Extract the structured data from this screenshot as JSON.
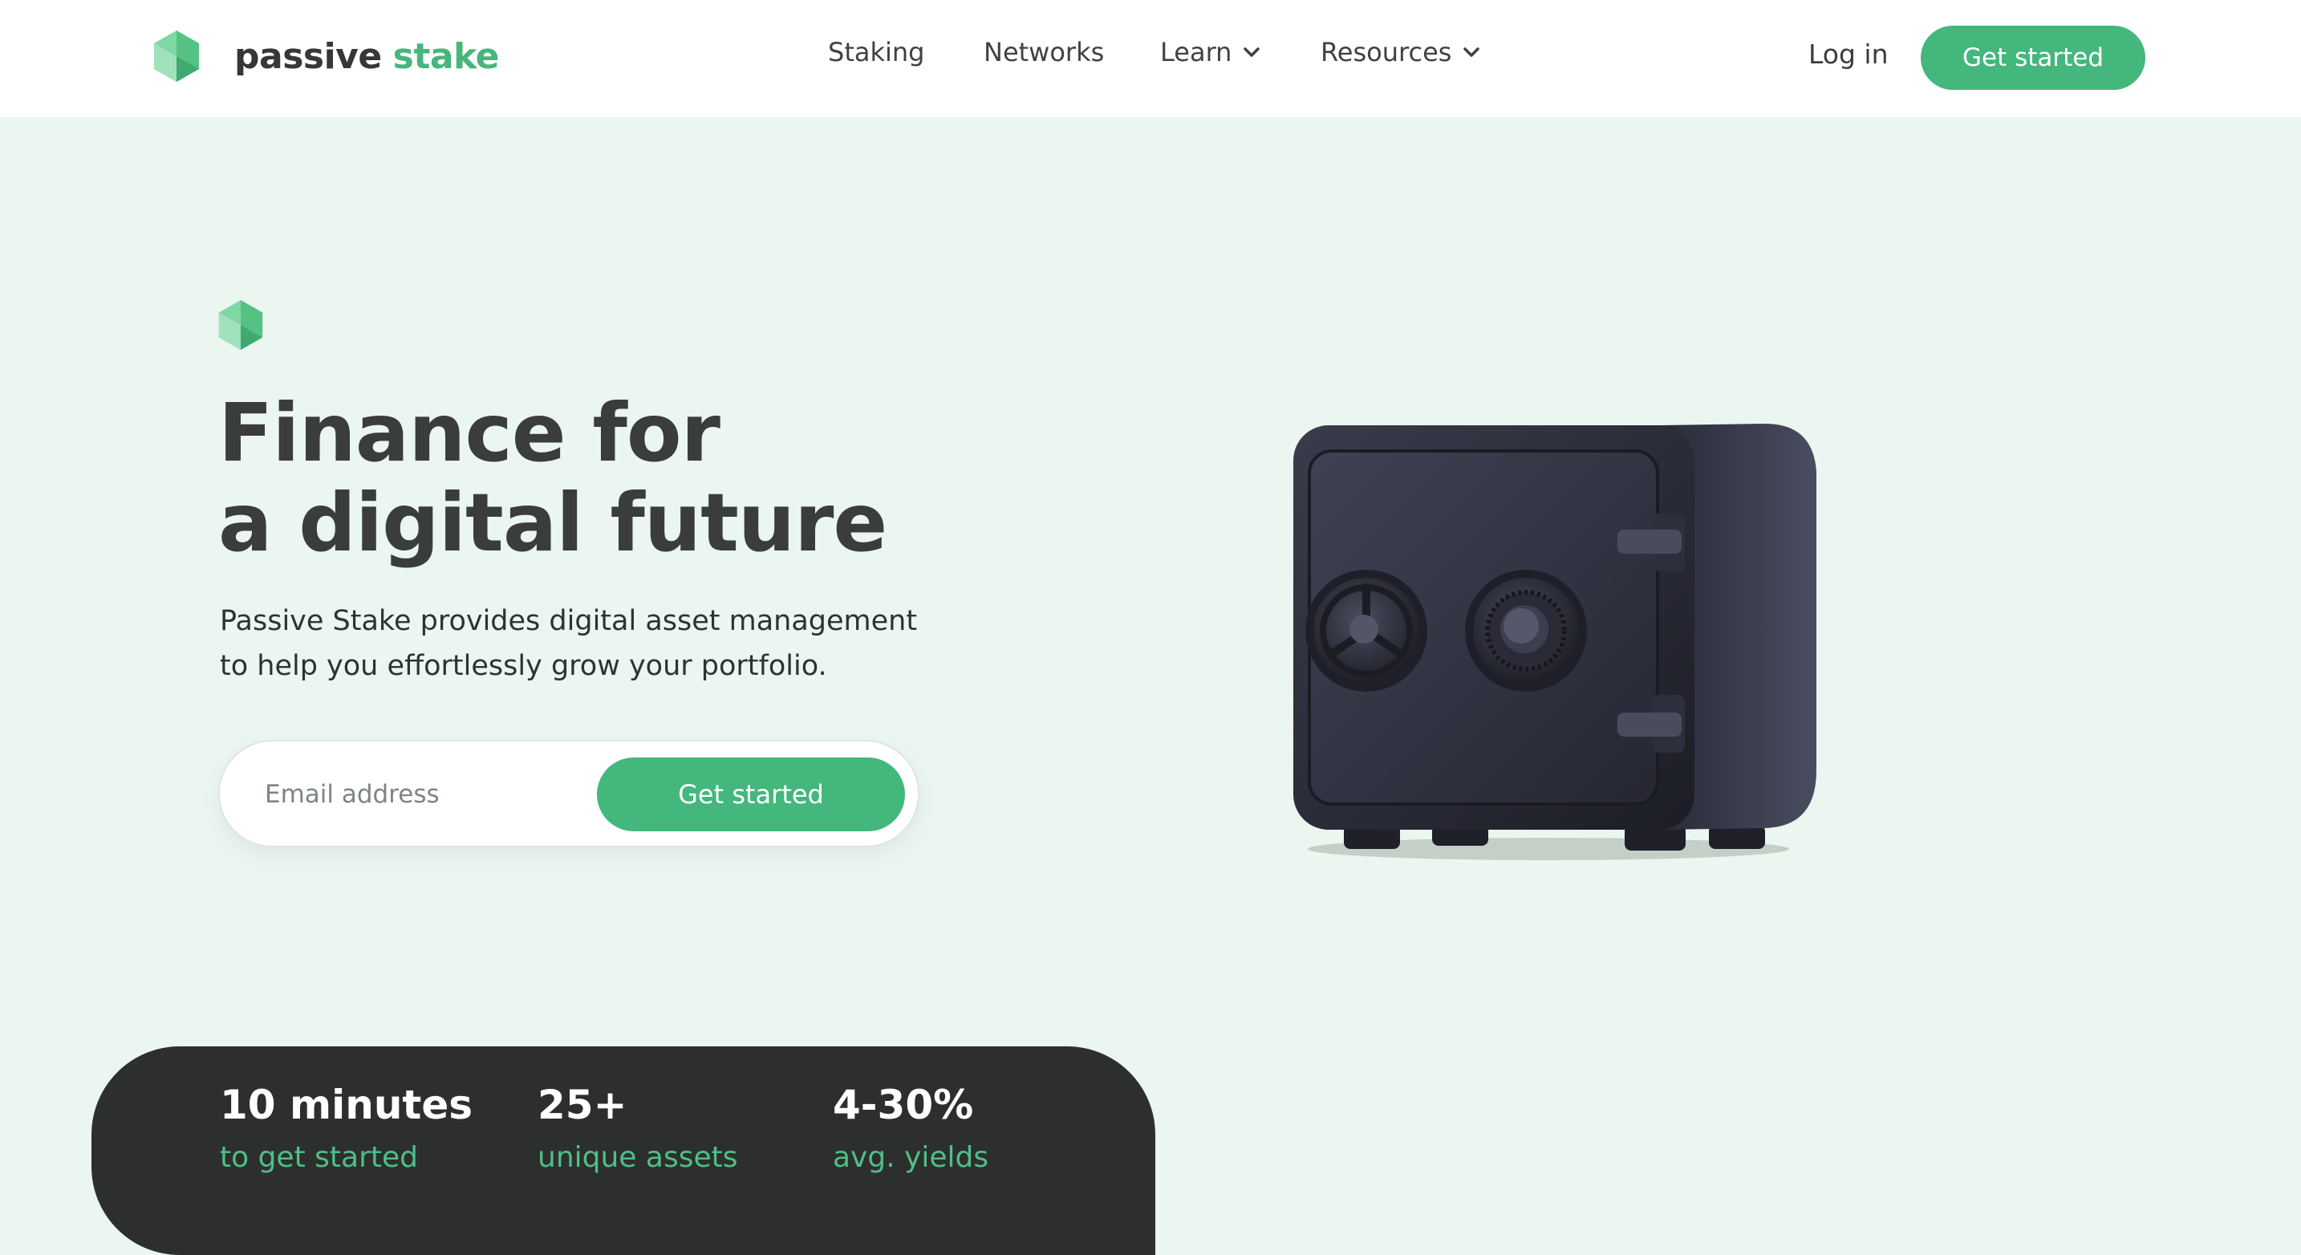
{
  "brand": {
    "word1": "passive",
    "word2": "stake"
  },
  "nav": {
    "items": [
      {
        "label": "Staking",
        "has_dropdown": false
      },
      {
        "label": "Networks",
        "has_dropdown": false
      },
      {
        "label": "Learn",
        "has_dropdown": true
      },
      {
        "label": "Resources",
        "has_dropdown": true
      }
    ],
    "login_label": "Log in",
    "cta_label": "Get started"
  },
  "hero": {
    "title_line1": "Finance for",
    "title_line2": "a digital future",
    "subtitle": "Passive Stake provides digital asset management to help you effortlessly grow your portfolio.",
    "email_placeholder": "Email address",
    "cta_label": "Get started"
  },
  "stats": [
    {
      "value": "10 minutes",
      "label": "to get started"
    },
    {
      "value": "25+",
      "label": "unique assets"
    },
    {
      "value": "4-30%",
      "label": "avg. yields"
    }
  ],
  "colors": {
    "accent": "#44b77c",
    "hero_background": "#eaf6ef",
    "stats_background": "#2d2f2e",
    "text_dark": "#3a3d3b"
  },
  "icons": [
    "hexagon-logo-icon",
    "chevron-down-icon",
    "safe-illustration"
  ]
}
